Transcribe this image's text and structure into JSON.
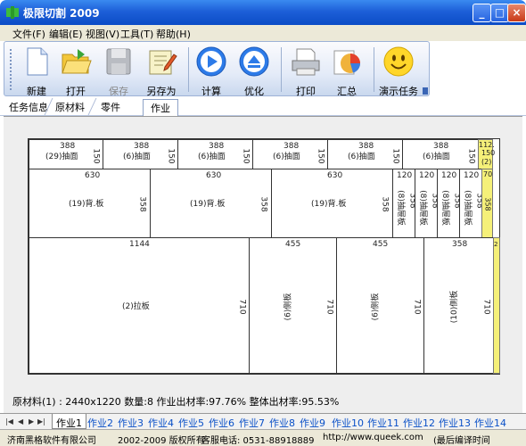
{
  "window": {
    "title": "极限切割 2009",
    "min": "_",
    "max": "□",
    "close": "×"
  },
  "menu": [
    "文件(F)",
    "编辑(E)",
    "视图(V)",
    "工具(T)",
    "帮助(H)"
  ],
  "toolbar": {
    "new": "新建",
    "open": "打开",
    "save": "保存",
    "saveas": "另存为",
    "calc": "计算",
    "optimize": "优化",
    "print": "打印",
    "summary": "汇总",
    "demo": "演示任务"
  },
  "panel_tabs": [
    "任务信息",
    "原材料",
    "零件",
    "作业"
  ],
  "layout": {
    "row1": [
      {
        "w": "388",
        "h": "150",
        "label": "(29)抽面"
      },
      {
        "w": "388",
        "h": "150",
        "label": "(6)抽面"
      },
      {
        "w": "388",
        "h": "150",
        "label": "(6)抽面"
      },
      {
        "w": "388",
        "h": "150",
        "label": "(6)抽面"
      },
      {
        "w": "388",
        "h": "150",
        "label": "(6)抽面"
      },
      {
        "w": "388",
        "h": "150",
        "label": "(6)抽面"
      }
    ],
    "row1_scrap": {
      "w": "112.",
      "h": "150",
      "extra": "(2)"
    },
    "row2": [
      {
        "w": "630",
        "h": "358",
        "label": "(19)背.板"
      },
      {
        "w": "630",
        "h": "358",
        "label": "(19)背.板"
      },
      {
        "w": "630",
        "h": "358",
        "label": "(19)背.板"
      }
    ],
    "row2_narrow": [
      {
        "w": "120",
        "h": "358",
        "label": "(8)抽屉板"
      },
      {
        "w": "120",
        "h": "358",
        "label": "(8)抽屉板"
      },
      {
        "w": "120",
        "h": "358",
        "label": "(8)抽屉板"
      },
      {
        "w": "120",
        "h": "358",
        "label": "(8)抽屉板"
      }
    ],
    "row2_scrap": {
      "w": "70",
      "h": "358"
    },
    "row3": [
      {
        "w": "1144",
        "h": "710",
        "label": "(2)拉板"
      },
      {
        "w": "455",
        "h": "710",
        "label": "(6)侧板"
      },
      {
        "w": "455",
        "h": "710",
        "label": "(6)侧板"
      },
      {
        "w": "358",
        "h": "710",
        "label": "(10)侧板"
      }
    ],
    "scrap_w": "2"
  },
  "summary": "原材料(1) : 2440x1220  数量:8  作业出材率:97.76%  整体出材率:95.53%",
  "job_tabs": [
    "作业1",
    "作业2",
    "作业3",
    "作业4",
    "作业5",
    "作业6",
    "作业7",
    "作业8",
    "作业9",
    "作业10",
    "作业11",
    "作业12",
    "作业13",
    "作业14"
  ],
  "nav": [
    "|◀",
    "◀",
    "▶",
    "▶|"
  ],
  "status": {
    "company": "济南黑格软件有限公司",
    "copyright": "2002-2009 版权所有",
    "phone": "客服电话: 0531-88918889",
    "url": "http://www.queek.com",
    "last": "(最后编译时间"
  },
  "colors": {
    "title": "#0b4cc6",
    "scrap": "#f5f079",
    "tab_link": "#0a50c8"
  }
}
